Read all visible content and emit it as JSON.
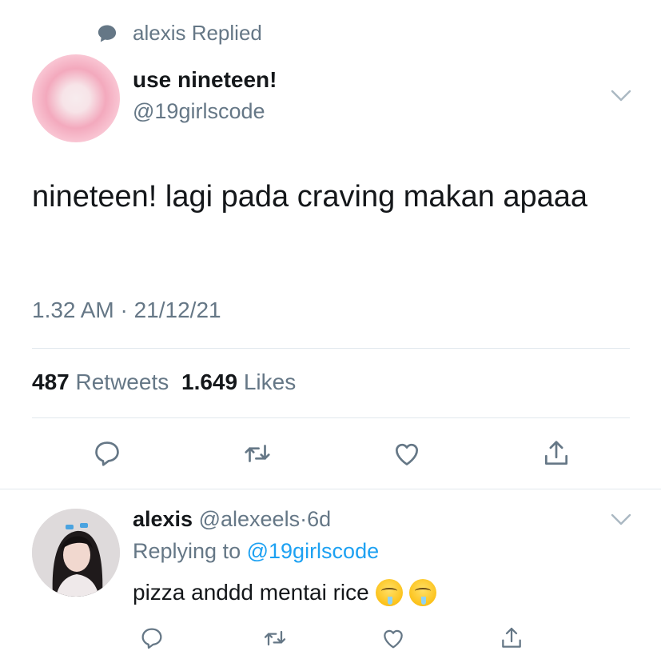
{
  "context": {
    "icon": "speech-bubble-icon",
    "text": "alexis Replied"
  },
  "tweet": {
    "display_name": "use nineteen!",
    "handle": "@19girlscode",
    "text": "nineteen! lagi pada craving makan apaaa",
    "timestamp": "1.32 AM · 21/12/21",
    "retweets_count": "487",
    "retweets_label": "Retweets",
    "likes_count": "1.649",
    "likes_label": "Likes"
  },
  "actions": [
    "reply-icon",
    "retweet-icon",
    "heart-icon",
    "share-icon"
  ],
  "reply": {
    "name": "alexis",
    "handle": "@alexeels",
    "separator": "·",
    "age": "6d",
    "replying_prefix": "Replying to",
    "replying_to": "@19girlscode",
    "text": "pizza anddd mentai rice",
    "emoji": [
      "drooling-face-emoji",
      "drooling-face-emoji"
    ]
  },
  "colors": {
    "accent": "#1da1f2",
    "muted": "#657786",
    "divider": "#e1e8ed",
    "text": "#14171a"
  }
}
